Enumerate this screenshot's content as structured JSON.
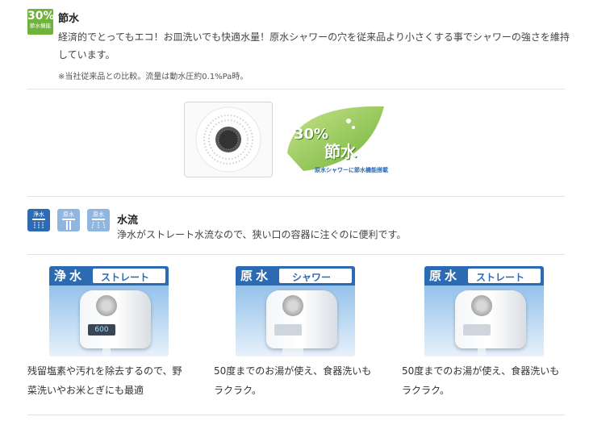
{
  "section1": {
    "badge": {
      "big": "30%",
      "small": "節水機能"
    },
    "title": "節水",
    "description": "経済的でとってもエコ！お皿洗いでも快適水量！原水シャワーの穴を従来品より小さくする事でシャワーの強さを維持しています。",
    "note": "※当社従来品との比較。流量は動水圧約0.1%Pa時。",
    "logo": {
      "big_pct": "30%",
      "big_word": "節水",
      "caption": "原水シャワーに節水機能搭載"
    }
  },
  "section2": {
    "mode_icons": [
      {
        "label": "浄水",
        "icon": "shower-icon-active"
      },
      {
        "label": "原水",
        "icon": "straight-icon"
      },
      {
        "label": "原水",
        "icon": "shower-icon"
      }
    ],
    "title": "水流",
    "description": "浄水がストレート水流なので、狭い口の容器に注ぐのに便利です。"
  },
  "cards": [
    {
      "mode": "浄水",
      "type": "ストレート",
      "display": "600",
      "caption": "残留塩素や汚れを除去するので、野菜洗いやお米とぎにも最適"
    },
    {
      "mode": "原水",
      "type": "シャワー",
      "display": "",
      "caption": "50度までのお湯が使え、食器洗いもラクラク。"
    },
    {
      "mode": "原水",
      "type": "ストレート",
      "display": "",
      "caption": "50度までのお湯が使え、食器洗いもラクラク。"
    }
  ],
  "colors": {
    "green": "#6fb33a",
    "blue": "#2c6bb3",
    "lightblue": "#8fb6df"
  }
}
